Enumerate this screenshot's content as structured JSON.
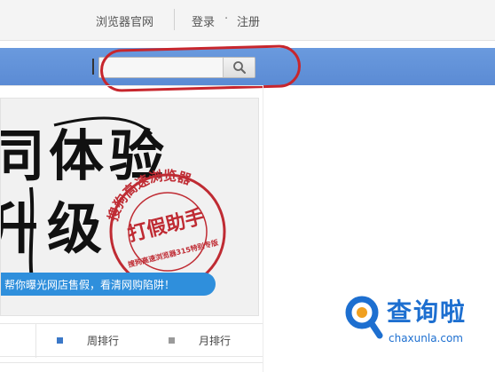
{
  "header": {
    "browser_site_link": "浏览器官网",
    "login_link": "登录",
    "dot": "·",
    "register_link": "注册"
  },
  "search": {
    "value": "",
    "placeholder": "",
    "button_icon": "search-icon"
  },
  "banner": {
    "headline_line1": "同体验",
    "headline_line2": "升级",
    "seal_ring_text": "搜狗高速浏览器",
    "seal_center_text": "打假助手",
    "seal_inner_text": "搜狗高速浏览器315特别专版",
    "ticker_text": "帮你曝光网店售假，看清网购陷阱！"
  },
  "ranking": {
    "tabs": [
      {
        "label": "周排行"
      },
      {
        "label": "月排行"
      }
    ]
  },
  "watermark": {
    "title": "查询啦",
    "domain": "chaxunla.com"
  },
  "colors": {
    "nav_blue": "#5b8bd4",
    "highlight_red": "#c7262d",
    "ticker_blue": "#2f8fdc",
    "watermark_blue": "#1d6fd0",
    "seal_red": "#bf2b33"
  }
}
